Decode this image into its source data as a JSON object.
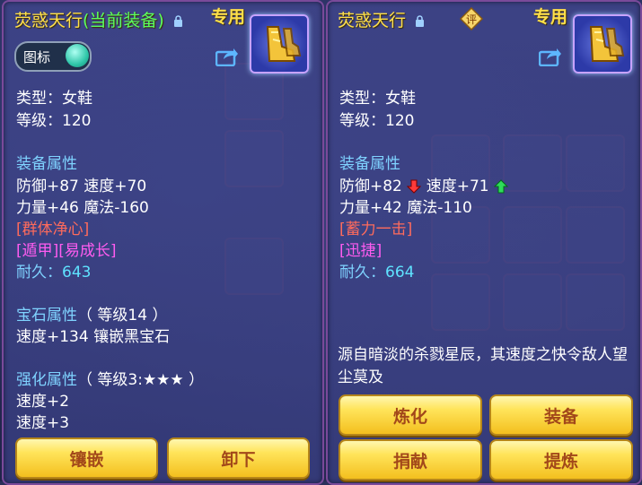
{
  "left": {
    "title_name": "荧惑天行",
    "title_current": "(当前装备)",
    "exclusive": "专用",
    "toggle_label": "图标",
    "type_line": "类型：女鞋",
    "level_line": "等级：120",
    "equip_attr_header": "装备属性",
    "attr1": "防御+87 速度+70",
    "attr2": "力量+46 魔法-160",
    "special1": "[群体净心]",
    "special2": "[遁甲][易成长]",
    "durability_label": "耐久：",
    "durability_value": "643",
    "gem_header": "宝石属性",
    "gem_level": "（ 等级14 ）",
    "gem_line": "速度+134 镶嵌黑宝石",
    "enhance_header": "强化属性",
    "enhance_level": "（ 等级3:★★★ ）",
    "enhance1": "速度+2",
    "enhance2": "速度+3",
    "buttons": [
      "镶嵌",
      "卸下"
    ]
  },
  "right": {
    "title_name": "荧惑天行",
    "exclusive": "专用",
    "rate_icon_label": "评",
    "type_line": "类型：女鞋",
    "level_line": "等级：120",
    "equip_attr_header": "装备属性",
    "attr1a": "防御+82",
    "attr1b": "速度+71",
    "attr2": "力量+42 魔法-110",
    "special1": "[蓄力一击]",
    "special2": "[迅捷]",
    "durability_label": "耐久：",
    "durability_value": "664",
    "description": "源自暗淡的杀戮星辰，其速度之快令敌人望尘莫及",
    "buttons": [
      "炼化",
      "装备",
      "捐献",
      "提炼"
    ]
  },
  "colors": {
    "title": "#ffe04a",
    "current": "#5cff5c",
    "section": "#7fd3ff",
    "special_red": "#ff6b5c",
    "special_pink": "#ff5cf0",
    "durability": "#5fe3ff",
    "button": "#ffe45a"
  },
  "icons": [
    "lock-icon",
    "share-icon",
    "boots-icon",
    "rate-icon",
    "arrow-down-icon",
    "arrow-up-icon"
  ]
}
